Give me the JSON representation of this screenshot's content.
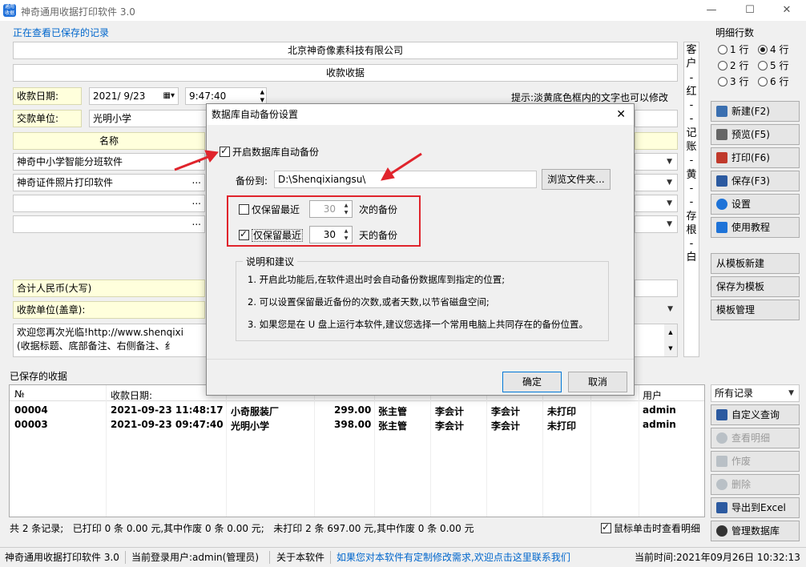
{
  "window": {
    "title": "神奇通用收据打印软件 3.0",
    "icon_text": "通用收据",
    "min": "—",
    "max": "☐",
    "close": "✕"
  },
  "record_label": "正在查看已保存的记录",
  "receipt": {
    "company": "北京神奇像素科技有限公司",
    "title": "收款收据",
    "date_label": "收款日期:",
    "date_value": "2021/ 9/23",
    "time_value": "9:47:40",
    "hint": "提示:淡黄底色框内的文字也可以修改",
    "payer_label": "交款单位:",
    "payer_value": "光明小学",
    "col_name": "名称",
    "items": [
      "神奇中小学智能分班软件",
      "神奇证件照片打印软件",
      "",
      ""
    ],
    "ellipsis": "...",
    "total_label": "合计人民币(大写)",
    "payee_label": "收款单位(盖章):",
    "note_line1": "欢迎您再次光临!http://www.shenqixi",
    "note_line2": "(收据标题、底部备注、右侧备注、纟"
  },
  "side_vertical": [
    "客",
    "户",
    "-",
    "红",
    "-",
    "-",
    "记",
    "账",
    "-",
    "黄",
    "-",
    "-",
    "存",
    "根",
    "-",
    "白"
  ],
  "right_panel": {
    "group_label": "明细行数",
    "radios": [
      {
        "label": "1 行",
        "on": false
      },
      {
        "label": "4 行",
        "on": true
      },
      {
        "label": "2 行",
        "on": false
      },
      {
        "label": "5 行",
        "on": false
      },
      {
        "label": "3 行",
        "on": false
      },
      {
        "label": "6 行",
        "on": false
      }
    ],
    "buttons": [
      {
        "label": "新建(F2)",
        "color": "#3a6fb0"
      },
      {
        "label": "预览(F5)",
        "color": "#666"
      },
      {
        "label": "打印(F6)",
        "color": "#c0392b"
      },
      {
        "label": "保存(F3)",
        "color": "#2c5aa0"
      },
      {
        "label": "设置",
        "color": "#1e73d8"
      },
      {
        "label": "使用教程",
        "color": "#1e73d8"
      }
    ],
    "template_buttons": [
      "从模板新建",
      "保存为模板",
      "模板管理"
    ]
  },
  "dialog": {
    "title": "数据库自动备份设置",
    "close": "✕",
    "enable_label": "开启数据库自动备份",
    "backup_to_label": "备份到:",
    "backup_path": "D:\\Shenqixiangsu\\",
    "browse": "浏览文件夹...",
    "keep_count_label": "仅保留最近",
    "keep_count_value": "30",
    "keep_count_unit": "次的备份",
    "keep_days_label": "仅保留最近",
    "keep_days_value": "30",
    "keep_days_unit": "天的备份",
    "notes_title": "说明和建议",
    "notes": [
      "1. 开启此功能后,在软件退出时会自动备份数据库到指定的位置;",
      "2. 可以设置保留最近备份的次数,或者天数,以节省磁盘空间;",
      "3. 如果您是在 U 盘上运行本软件,建议您选择一个常用电脑上共同存在的备份位置。"
    ],
    "ok": "确定",
    "cancel": "取消"
  },
  "saved": {
    "label": "已保存的收据",
    "headers": {
      "no": "№",
      "date": "收款日期:",
      "user": "用户"
    },
    "rows": [
      {
        "no": "00004",
        "date": "2021-09-23 11:48:17",
        "payer": "小奇服装厂",
        "amount": "299.00",
        "c1": "张主管",
        "c2": "李会计",
        "c3": "李会计",
        "status": "未打印",
        "user": "admin"
      },
      {
        "no": "00003",
        "date": "2021-09-23 09:47:40",
        "payer": "光明小学",
        "amount": "398.00",
        "c1": "张主管",
        "c2": "李会计",
        "c3": "李会计",
        "status": "未打印",
        "user": "admin"
      }
    ],
    "summary": "共 2 条记录;   已打印 0 条 0.00 元,其中作废 0 条 0.00 元;   未打印 2 条 697.00 元,其中作废 0 条 0.00 元",
    "filter": "所有记录",
    "buttons": [
      {
        "label": "自定义查询",
        "dis": false,
        "color": "#2c5aa0"
      },
      {
        "label": "查看明细",
        "dis": true,
        "color": "#9aa"
      },
      {
        "label": "作废",
        "dis": true,
        "color": "#9aa"
      },
      {
        "label": "删除",
        "dis": true,
        "color": "#9aa"
      },
      {
        "label": "导出到Excel",
        "dis": false,
        "color": "#2c5aa0"
      },
      {
        "label": "管理数据库",
        "dis": false,
        "color": "#333"
      }
    ],
    "click_detail": "鼠标单击时查看明细"
  },
  "statusbar": {
    "app": "神奇通用收据打印软件 3.0",
    "user": "当前登录用户:admin(管理员)",
    "about": "关于本软件",
    "contact": "如果您对本软件有定制修改需求,欢迎点击这里联系我们",
    "time": "当前时间:2021年09月26日 10:32:13"
  }
}
